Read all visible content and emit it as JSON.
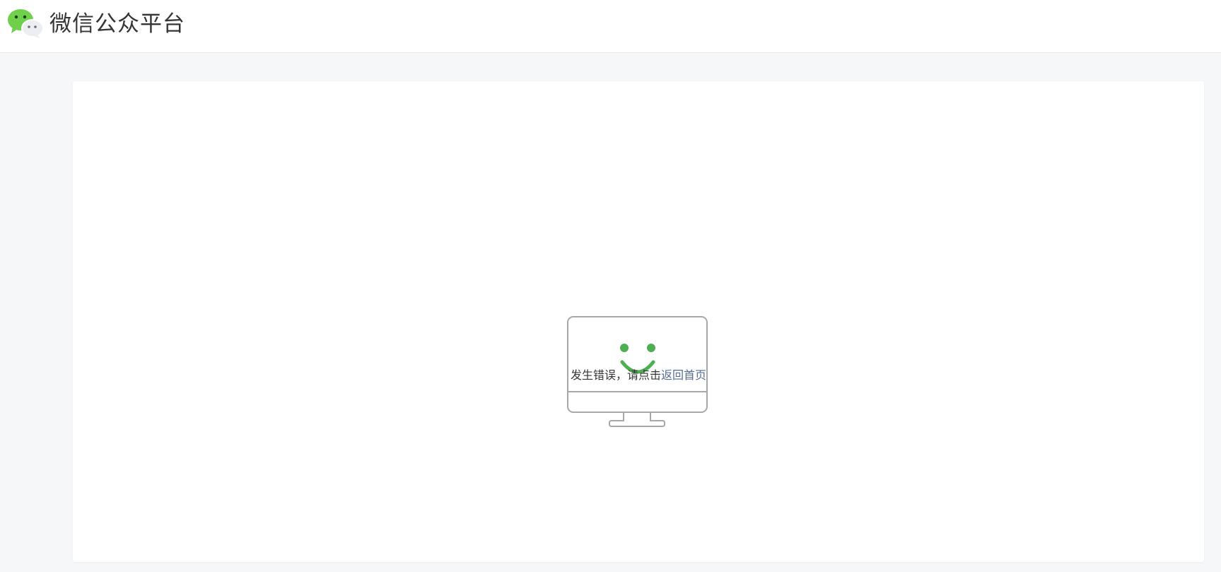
{
  "header": {
    "title": "微信公众平台",
    "logo_icon": "wechat-logo-icon"
  },
  "error": {
    "illustration_icon": "monitor-smile-icon",
    "message": "发生错误，请点击",
    "link_label": "返回首页"
  },
  "colors": {
    "brand_green": "#4caf50",
    "link_blue": "#576b95",
    "text": "#353535",
    "page_bg": "#f6f7f9",
    "monitor_stroke": "#a8a8a8"
  }
}
